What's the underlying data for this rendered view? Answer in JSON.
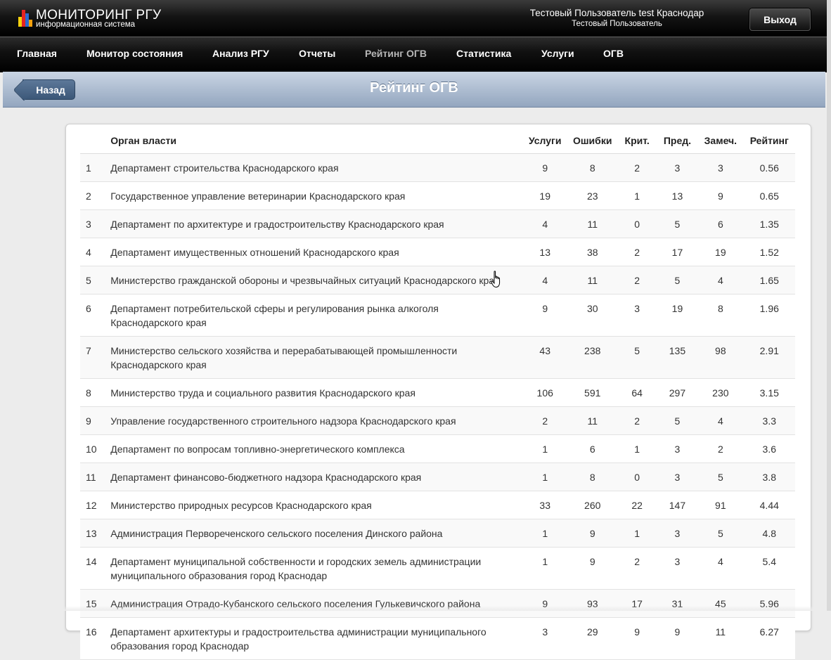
{
  "header": {
    "logo_title": "МОНИТОРИНГ РГУ",
    "logo_subtitle": "информационная система",
    "user_name": "Тестовый Пользователь test Краснодар",
    "user_role": "Тестовый Пользователь",
    "logout_label": "Выход"
  },
  "nav": {
    "items": [
      "Главная",
      "Монитор состояния",
      "Анализ РГУ",
      "Отчеты",
      "Рейтинг ОГВ",
      "Статистика",
      "Услуги",
      "ОГВ"
    ],
    "active": "Рейтинг ОГВ"
  },
  "subheader": {
    "back_label": "Назад",
    "title": "Рейтинг ОГВ"
  },
  "table": {
    "columns": [
      "",
      "Орган власти",
      "Услуги",
      "Ошибки",
      "Крит.",
      "Пред.",
      "Замеч.",
      "Рейтинг"
    ],
    "rows": [
      [
        "1",
        "Департамент строительства Краснодарского края",
        "9",
        "8",
        "2",
        "3",
        "3",
        "0.56"
      ],
      [
        "2",
        "Государственное управление ветеринарии Краснодарского края",
        "19",
        "23",
        "1",
        "13",
        "9",
        "0.65"
      ],
      [
        "3",
        "Департамент по архитектуре и градостроительству Краснодарского края",
        "4",
        "11",
        "0",
        "5",
        "6",
        "1.35"
      ],
      [
        "4",
        "Департамент имущественных отношений Краснодарского края",
        "13",
        "38",
        "2",
        "17",
        "19",
        "1.52"
      ],
      [
        "5",
        "Министерство гражданской обороны и чрезвычайных ситуаций Краснодарского края",
        "4",
        "11",
        "2",
        "5",
        "4",
        "1.65"
      ],
      [
        "6",
        "Департамент потребительской сферы и регулирования рынка алкоголя Краснодарского края",
        "9",
        "30",
        "3",
        "19",
        "8",
        "1.96"
      ],
      [
        "7",
        "Министерство сельского хозяйства и перерабатывающей промышленности Краснодарского края",
        "43",
        "238",
        "5",
        "135",
        "98",
        "2.91"
      ],
      [
        "8",
        "Министерство труда и социального развития Краснодарского края",
        "106",
        "591",
        "64",
        "297",
        "230",
        "3.15"
      ],
      [
        "9",
        "Управление государственного строительного надзора Краснодарского края",
        "2",
        "11",
        "2",
        "5",
        "4",
        "3.3"
      ],
      [
        "10",
        "Департамент по вопросам топливно-энергетического комплекса",
        "1",
        "6",
        "1",
        "3",
        "2",
        "3.6"
      ],
      [
        "11",
        "Департамент финансово-бюджетного надзора Краснодарского края",
        "1",
        "8",
        "0",
        "3",
        "5",
        "3.8"
      ],
      [
        "12",
        "Министерство природных ресурсов Краснодарского края",
        "33",
        "260",
        "22",
        "147",
        "91",
        "4.44"
      ],
      [
        "13",
        "Администрация Первореченского сельского поселения Динского района",
        "1",
        "9",
        "1",
        "3",
        "5",
        "4.8"
      ],
      [
        "14",
        "Департамент муниципальной собственности и городских земель администрации муниципального образования город Краснодар",
        "1",
        "9",
        "2",
        "3",
        "4",
        "5.4"
      ],
      [
        "15",
        "Администрация Отрадо-Кубанского сельского поселения Гулькевичского района",
        "9",
        "93",
        "17",
        "31",
        "45",
        "5.96"
      ],
      [
        "16",
        "Департамент архитектуры и градостроительства администрации муниципального образования город Краснодар",
        "3",
        "29",
        "9",
        "9",
        "11",
        "6.27"
      ]
    ]
  },
  "colors": {
    "logo_bars": [
      "#f5d10d",
      "#e52421",
      "#2a6bd1",
      "#f5a10d"
    ]
  },
  "icons": {
    "cursor": "hand-pointer-icon"
  }
}
